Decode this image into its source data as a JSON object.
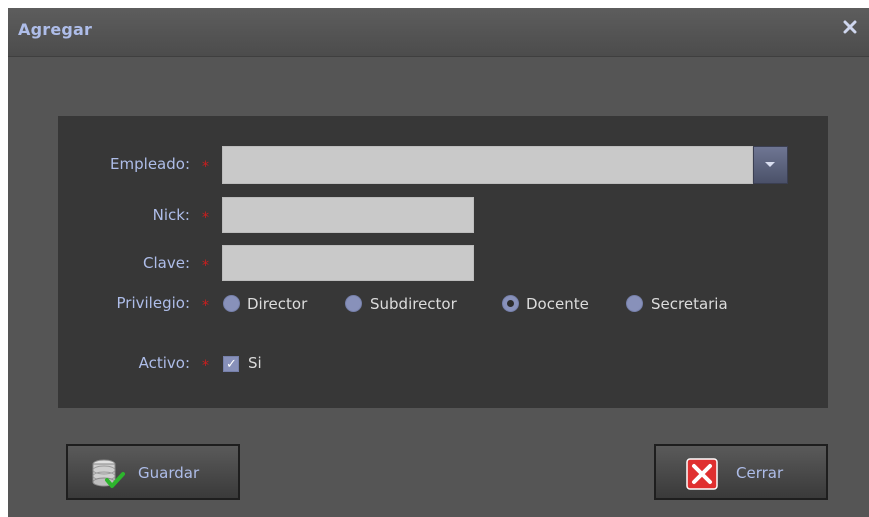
{
  "dialog": {
    "title": "Agregar",
    "close_icon": "close-icon"
  },
  "form": {
    "empleado": {
      "label": "Empleado:",
      "value": "",
      "required_mark": "*"
    },
    "nick": {
      "label": "Nick:",
      "value": "",
      "required_mark": "*"
    },
    "clave": {
      "label": "Clave:",
      "value": "",
      "required_mark": "*"
    },
    "privilegio": {
      "label": "Privilegio:",
      "required_mark": "*",
      "options": [
        "Director",
        "Subdirector",
        "Docente",
        "Secretaria"
      ],
      "selected": "Docente"
    },
    "activo": {
      "label": "Activo:",
      "required_mark": "*",
      "checkbox_label": "Si",
      "checked": true
    }
  },
  "buttons": {
    "guardar": "Guardar",
    "cerrar": "Cerrar"
  },
  "colors": {
    "accent_text": "#aebde9",
    "required": "#cc1e1e",
    "radio": "#8891ba"
  },
  "icons": [
    "close-icon",
    "chevron-down-icon",
    "database-save-icon",
    "close-x-icon"
  ]
}
